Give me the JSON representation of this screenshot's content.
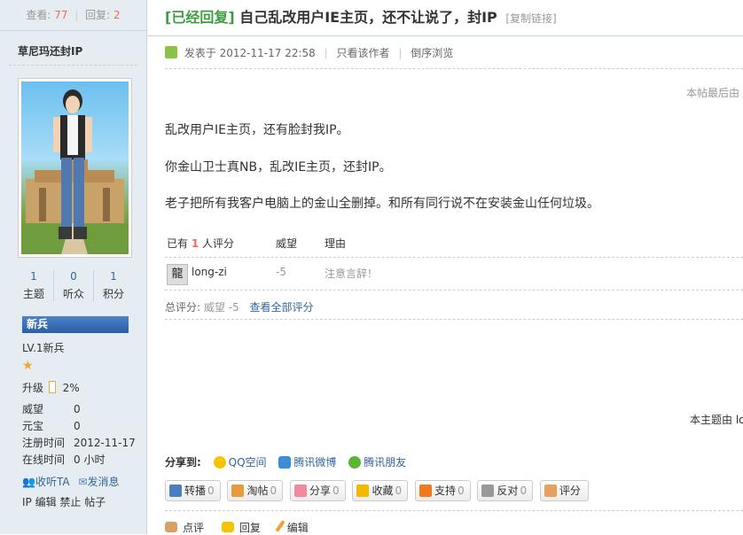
{
  "sidebar": {
    "views_label": "查看:",
    "views_value": "77",
    "replies_label": "回复:",
    "replies_value": "2",
    "username": "草尼玛还封IP",
    "counts": [
      {
        "value": "1",
        "label": "主题"
      },
      {
        "value": "0",
        "label": "听众"
      },
      {
        "value": "1",
        "label": "积分"
      }
    ],
    "rank_title": "新兵",
    "level": "LV.1新兵",
    "upgrade_label": "升级",
    "upgrade_percent": "2%",
    "upgrade_progress": 0.02,
    "fields": [
      {
        "key": "威望",
        "value": "0"
      },
      {
        "key": "元宝",
        "value": "0"
      },
      {
        "key": "注册时间",
        "value": "2012-11-17"
      },
      {
        "key": "在线时间",
        "value": "0 小时"
      }
    ],
    "follow_label": "收听TA",
    "message_label": "发消息",
    "admin_links": "IP 编辑 禁止 帖子"
  },
  "post": {
    "tag": "[已经回复]",
    "title": "自己乱改用户IE主页，还不让说了，封IP",
    "copy_link": "[复制链接]",
    "posted_at": "发表于 2012-11-17 22:58",
    "only_author": "只看该作者",
    "reverse_order": "倒序浏览",
    "last_edit_note": "本帖最后由",
    "paragraphs": [
      "乱改用户IE主页，还有脸封我IP。",
      "你金山卫士真NB，乱改IE主页，还封IP。",
      "老子把所有我客户电脑上的金山全删掉。和所有同行说不在安装金山任何垃圾。"
    ]
  },
  "rating": {
    "prefix": "已有",
    "count": "1",
    "suffix": "人评分",
    "col_weiwang": "威望",
    "col_reason": "理由",
    "rows": [
      {
        "avatar_char": "龍",
        "user": "long-zi",
        "weiwang": "-5",
        "reason": "注意言辞！"
      }
    ],
    "total_label": "总评分:",
    "total_value": "威望 -5",
    "view_all": "查看全部评分"
  },
  "tail_note": "本主题由 lo",
  "share": {
    "label": "分享到:",
    "items": [
      "QQ空间",
      "腾讯微博",
      "腾讯朋友"
    ]
  },
  "buttons": [
    {
      "label": "转播",
      "count": "0",
      "color": "#4a7fc1",
      "icon": "repost-icon"
    },
    {
      "label": "淘帖",
      "count": "0",
      "color": "#e89a3c",
      "icon": "collect-icon"
    },
    {
      "label": "分享",
      "count": "0",
      "color": "#f08aa0",
      "icon": "heart-icon"
    },
    {
      "label": "收藏",
      "count": "0",
      "color": "#f5b800",
      "icon": "star-icon"
    },
    {
      "label": "支持",
      "count": "0",
      "color": "#f07a1e",
      "icon": "thumb-up-icon"
    },
    {
      "label": "反对",
      "count": "0",
      "color": "#999999",
      "icon": "thumb-down-icon"
    },
    {
      "label": "评分",
      "count": "",
      "color": "#e8a060",
      "icon": "rate-hand-icon"
    }
  ],
  "actions": [
    "点评",
    "回复",
    "编辑"
  ]
}
